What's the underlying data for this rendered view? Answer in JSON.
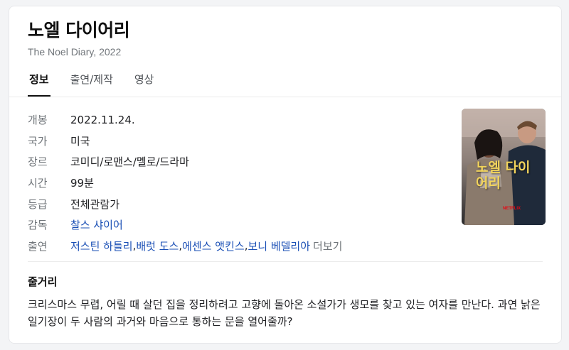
{
  "title": "노엘 다이어리",
  "subtitle": "The Noel Diary, 2022",
  "tabs": [
    {
      "label": "정보",
      "active": true
    },
    {
      "label": "출연/제작",
      "active": false
    },
    {
      "label": "영상",
      "active": false
    }
  ],
  "info": {
    "release": {
      "label": "개봉",
      "value": "2022.11.24."
    },
    "country": {
      "label": "국가",
      "value": "미국"
    },
    "genre": {
      "label": "장르",
      "value": "코미디/로맨스/멜로/드라마"
    },
    "runtime": {
      "label": "시간",
      "value": "99분"
    },
    "rating": {
      "label": "등급",
      "value": "전체관람가"
    },
    "director": {
      "label": "감독",
      "value": "찰스 샤이어"
    },
    "cast": {
      "label": "출연",
      "names": [
        "저스틴 하틀리",
        "배럿 도스",
        "에센스 앳킨스",
        "보니 베델리아"
      ],
      "separator": ", ",
      "more": "더보기"
    }
  },
  "poster": {
    "title": "노엘 다이어리",
    "brand": "NETFLIX"
  },
  "synopsis": {
    "heading": "줄거리",
    "text": "크리스마스 무렵, 어릴 때 살던 집을 정리하려고 고향에 돌아온 소설가가 생모를 찾고 있는 여자를 만난다. 과연 낡은 일기장이 두 사람의 과거와 마음으로 통하는 문을 열어줄까?"
  },
  "colors": {
    "link": "#1a4fb5",
    "muted": "#70757a",
    "poster_title": "#f2d45c"
  }
}
